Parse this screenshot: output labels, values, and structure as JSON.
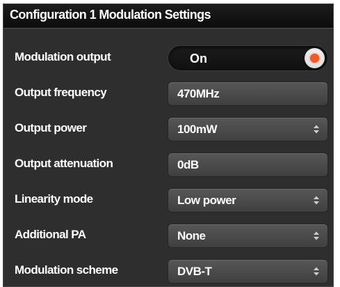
{
  "panel": {
    "title": "Configuration 1 Modulation Settings"
  },
  "modulation_output": {
    "label": "Modulation output",
    "value": "On",
    "indicator_color": "#f05a28"
  },
  "output_frequency": {
    "label": "Output frequency",
    "value": "470MHz"
  },
  "output_power": {
    "label": "Output power",
    "value": "100mW"
  },
  "output_attenuation": {
    "label": "Output attenuation",
    "value": "0dB"
  },
  "linearity_mode": {
    "label": "Linearity mode",
    "value": "Low power"
  },
  "additional_pa": {
    "label": "Additional PA",
    "value": "None"
  },
  "modulation_scheme": {
    "label": "Modulation scheme",
    "value": "DVB-T"
  },
  "icons": {
    "select": "up-down-chevron-icon",
    "toggle_indicator": "record-indicator-icon"
  },
  "colors": {
    "panel_background": "#2e2e2e",
    "header_background": "#111111",
    "field_background": "#4c4c4c",
    "text": "#ffffff"
  }
}
